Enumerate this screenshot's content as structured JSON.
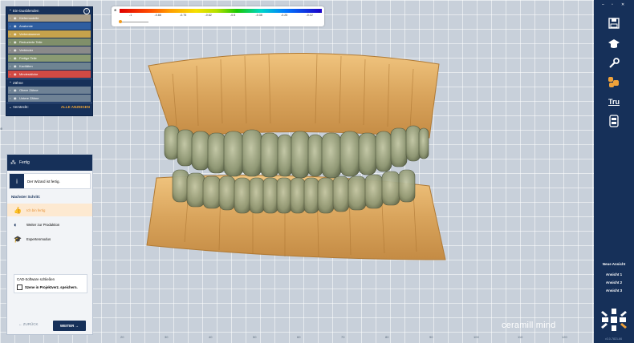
{
  "layers": {
    "header": "Ein-/ausblenden",
    "items": [
      {
        "label": "Kiefermodelle",
        "color": "#a79c87"
      },
      {
        "label": "Anatomie",
        "color": "#2f5ea0"
      },
      {
        "label": "Verbeokanmer",
        "color": "#c6a34c"
      },
      {
        "label": "Reduzierte Teile",
        "color": "#808f6a"
      },
      {
        "label": "Verbinder",
        "color": "#8a8a8a"
      },
      {
        "label": "Fertige Teile",
        "color": "#8a9a73"
      },
      {
        "label": "Kavitäten",
        "color": "#6f8492"
      },
      {
        "label": "Mindestdicke",
        "color": "#d24a44"
      }
    ],
    "teeth_header": "Zähne",
    "teeth": [
      {
        "label": "Obere Zähne",
        "color": "#6f8295"
      },
      {
        "label": "Untere Zähne",
        "color": "#6f8295"
      }
    ],
    "hidden_label": "Versteckt:",
    "show_all": "ALLE ANZEIGEN"
  },
  "scale": {
    "title": "⊕",
    "ticks": [
      "-1",
      "-0.88",
      "-0.75",
      "-0.62",
      "-0.5",
      "-0.38",
      "-0.25",
      "-0.12"
    ]
  },
  "wizard": {
    "title": "Fertig",
    "message": "Der Wizard ist fertig.",
    "next_step": "Nächster Schritt:",
    "options": [
      {
        "label": "Ich bin fertig",
        "icon": "thumbs-up-icon",
        "active": true
      },
      {
        "label": "Weiter zur Produktion",
        "icon": "production-icon",
        "active": false
      },
      {
        "label": "Expertenmodus",
        "icon": "graduation-cap-icon",
        "active": false
      }
    ],
    "close_title": "CAD-Software schließen",
    "save_label": "Szene in Projektverz. speichern.",
    "back": "ZURÜCK",
    "forward": "WEITER"
  },
  "toolbar": {
    "icons": [
      "save-icon",
      "graduation-cap-icon",
      "wrench-icon",
      "teeth-icon",
      "tru-icon",
      "scan-icon"
    ],
    "tru_label": "Tru",
    "views_header": "Neue Ansicht",
    "views": [
      "Ansicht 1",
      "Ansicht 2",
      "Ansicht 3"
    ],
    "version": "v3.0-7821-66"
  },
  "brand": "ceramill mind",
  "ruler": [
    "20",
    "30",
    "40",
    "50",
    "60",
    "70",
    "80",
    "90",
    "100",
    "110",
    "120",
    "130"
  ]
}
